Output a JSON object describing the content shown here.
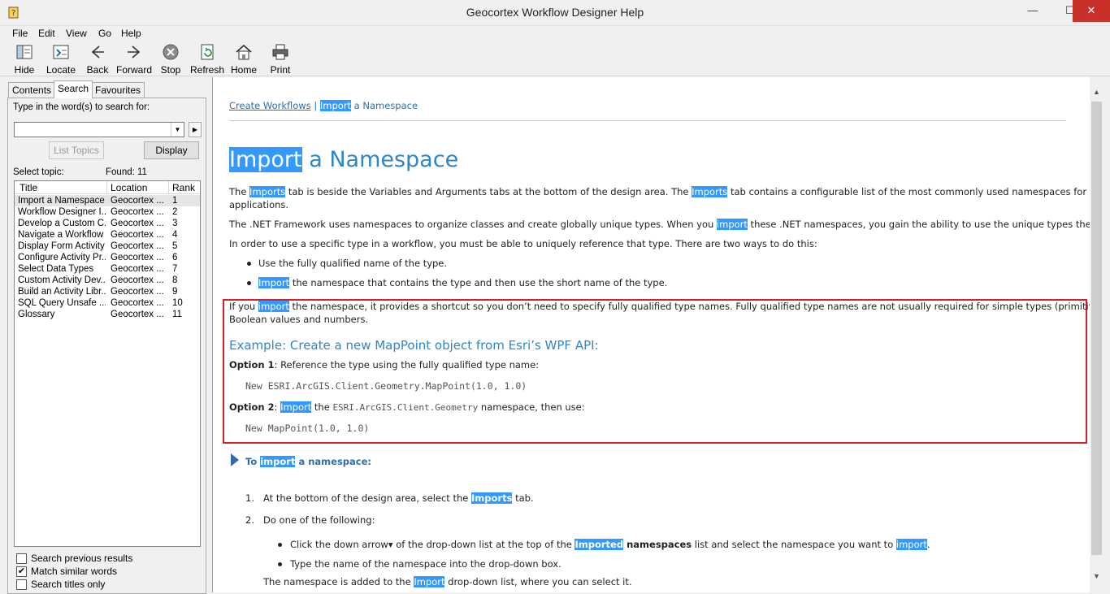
{
  "window": {
    "title": "Geocortex Workflow Designer Help",
    "controls": {
      "minimize": "—",
      "maximize": "☐",
      "close": "✕"
    }
  },
  "menu": [
    "File",
    "Edit",
    "View",
    "Go",
    "Help"
  ],
  "toolbar": [
    {
      "label": "Hide",
      "icon": "hide-icon"
    },
    {
      "label": "Locate",
      "icon": "locate-icon"
    },
    {
      "label": "Back",
      "icon": "back-arrow-icon"
    },
    {
      "label": "Forward",
      "icon": "forward-arrow-icon"
    },
    {
      "label": "Stop",
      "icon": "stop-icon"
    },
    {
      "label": "Refresh",
      "icon": "refresh-icon"
    },
    {
      "label": "Home",
      "icon": "home-icon"
    },
    {
      "label": "Print",
      "icon": "print-icon"
    }
  ],
  "left": {
    "tabs": [
      "Contents",
      "Search",
      "Favourites"
    ],
    "active_tab": "Search",
    "search_prompt": "Type in the word(s) to search for:",
    "search_value": "",
    "list_topics_label": "List Topics",
    "display_label": "Display",
    "select_topic_label": "Select topic:",
    "found_label": "Found: 11",
    "columns": [
      "Title",
      "Location",
      "Rank"
    ],
    "results": [
      {
        "title": "Import a Namespace",
        "location": "Geocortex ...",
        "rank": "1"
      },
      {
        "title": "Workflow Designer I...",
        "location": "Geocortex ...",
        "rank": "2"
      },
      {
        "title": "Develop a Custom C...",
        "location": "Geocortex ...",
        "rank": "3"
      },
      {
        "title": "Navigate a Workflow",
        "location": "Geocortex ...",
        "rank": "4"
      },
      {
        "title": "Display Form Activity",
        "location": "Geocortex ...",
        "rank": "5"
      },
      {
        "title": "Configure Activity Pr...",
        "location": "Geocortex ...",
        "rank": "6"
      },
      {
        "title": "Select Data Types",
        "location": "Geocortex ...",
        "rank": "7"
      },
      {
        "title": "Custom Activity Dev...",
        "location": "Geocortex ...",
        "rank": "8"
      },
      {
        "title": "Build an Activity Libr...",
        "location": "Geocortex ...",
        "rank": "9"
      },
      {
        "title": "SQL Query Unsafe ...",
        "location": "Geocortex ...",
        "rank": "10"
      },
      {
        "title": "Glossary",
        "location": "Geocortex ...",
        "rank": "11"
      }
    ],
    "checkboxes": [
      {
        "label": "Search previous results",
        "checked": false
      },
      {
        "label": "Match similar words",
        "checked": true
      },
      {
        "label": "Search titles only",
        "checked": false
      }
    ]
  },
  "content": {
    "breadcrumb_link": "Create Workflows",
    "breadcrumb_sep": " | ",
    "breadcrumb_hl": "Import",
    "breadcrumb_rest": " a Namespace",
    "heading_hl": "Import",
    "heading_rest": " a Namespace",
    "p1_a": "The ",
    "p1_hl1": "Imports",
    "p1_b": " tab is beside the Variables and Arguments tabs at the bottom of the design area. The ",
    "p1_hl2": "Imports",
    "p1_c": " tab contains a configurable list of the most commonly used namespaces for use in web GIS",
    "p1_d": "applications.",
    "p2_a": "The .NET Framework uses namespaces to organize classes and create globally unique types. When you ",
    "p2_hl": "import",
    "p2_b": " these .NET namespaces, you gain the ability to use the unique types they contain.",
    "p3": "In order to use a specific type in a workflow, you must be able to uniquely reference that type. There are two ways to do this:",
    "b1": "Use the fully qualified name of the type.",
    "b2_hl": "Import",
    "b2_rest": " the namespace that contains the type and then use the short name of the type.",
    "p4_a": "If you ",
    "p4_hl": "import",
    "p4_b": " the namespace, it provides a shortcut so you don’t need to specify fully qualified type names. Fully qualified type names are not usually required for simple types (primitives), such as",
    "p4_c": "Boolean values and numbers.",
    "example_heading": "Example: Create a new MapPoint object from Esri’s WPF API:",
    "opt1_bold": "Option 1",
    "opt1_rest": ": Reference the type using the fully qualified type name:",
    "code1": "New ESRI.ArcGIS.Client.Geometry.MapPoint(1.0, 1.0)",
    "opt2_bold": "Option 2",
    "opt2_sep": ": ",
    "opt2_hl": "Import",
    "opt2_mid": " the ",
    "opt2_code": "ESRI.ArcGIS.Client.Geometry",
    "opt2_end": " namespace, then use:",
    "code2": "New MapPoint(1.0, 1.0)",
    "proc_a": "To ",
    "proc_hl": "import",
    "proc_b": " a namespace:",
    "s1_num": "1.",
    "s1_a": "At the bottom of the design area, select the ",
    "s1_hl": "Imports",
    "s1_b": " tab.",
    "s2_num": "2.",
    "s2": "Do one of the following:",
    "sb1_a": "Click the down arrow",
    "sb1_arrow": "▾",
    "sb1_b": " of the drop-down list at the top of the ",
    "sb1_hl": "Imported",
    "sb1_bold": " namespaces",
    "sb1_c": " list and select the namespace you want to ",
    "sb1_hl2": "import",
    "sb1_d": ".",
    "sb2": "Type the name of the namespace into the drop-down box.",
    "last_a": "The namespace is added to the ",
    "last_hl": "Import",
    "last_b": " drop-down list, where you can select it."
  },
  "colors": {
    "highlight": "#3399ff",
    "heading": "#2f86c6",
    "link": "#2f6ea5",
    "annotation": "#d61f26"
  }
}
